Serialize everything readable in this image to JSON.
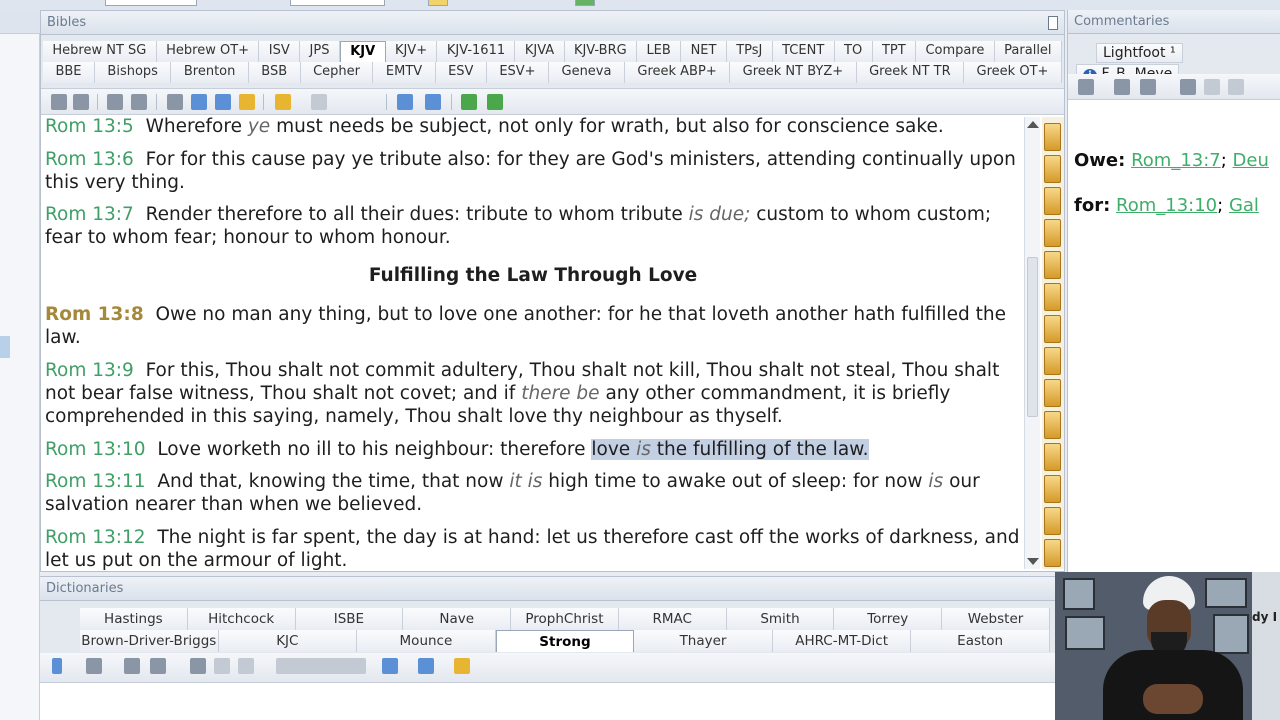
{
  "bibles_pane": {
    "title": "Bibles",
    "tabs_row1": [
      "Hebrew NT SG",
      "Hebrew OT+",
      "ISV",
      "JPS",
      "KJV",
      "KJV+",
      "KJV-1611",
      "KJVA",
      "KJV-BRG",
      "LEB",
      "NET",
      "TPsJ",
      "TCENT",
      "TO",
      "TPT",
      "Compare",
      "Parallel"
    ],
    "tabs_row2": [
      "BBE",
      "Bishops",
      "Brenton",
      "BSB",
      "Cepher",
      "EMTV",
      "ESV",
      "ESV+",
      "Geneva",
      "Greek ABP+",
      "Greek NT BYZ+",
      "Greek NT TR",
      "Greek OT+"
    ],
    "active_tab": "KJV",
    "verses": [
      {
        "ref": "Rom 13:5",
        "parts": [
          {
            "t": "Wherefore "
          },
          {
            "t": "ye",
            "i": true
          },
          {
            "t": " must needs be subject, not only for wrath, but also for conscience sake."
          }
        ]
      },
      {
        "ref": "Rom 13:6",
        "parts": [
          {
            "t": "For for this cause pay ye tribute also: for they are God's ministers, attending continually upon this very thing."
          }
        ]
      },
      {
        "ref": "Rom 13:7",
        "parts": [
          {
            "t": "Render therefore to all their dues: tribute to whom tribute "
          },
          {
            "t": "is due;",
            "i": true
          },
          {
            "t": " custom to whom custom; fear to whom fear; honour to whom honour."
          }
        ]
      },
      {
        "ref": "Rom 13:8",
        "current": true,
        "parts": [
          {
            "t": "Owe no man any thing, but to love one another: for he that loveth another hath fulfilled the law."
          }
        ]
      },
      {
        "ref": "Rom 13:9",
        "parts": [
          {
            "t": "For this, Thou shalt not commit adultery, Thou shalt not kill, Thou shalt not steal, Thou shalt not bear false witness, Thou shalt not covet; and if "
          },
          {
            "t": "there be",
            "i": true
          },
          {
            "t": " any other commandment, it is briefly comprehended in this saying, namely, Thou shalt love thy neighbour as thyself."
          }
        ]
      },
      {
        "ref": "Rom 13:10",
        "parts": [
          {
            "t": "Love worketh no ill to his neighbour: therefore "
          },
          {
            "t": "love ",
            "h": true
          },
          {
            "t": "is",
            "i": true,
            "h": true
          },
          {
            "t": " the fulfilling of the law.",
            "h": true
          }
        ]
      },
      {
        "ref": "Rom 13:11",
        "parts": [
          {
            "t": "And that, knowing the time, that now "
          },
          {
            "t": "it is",
            "i": true
          },
          {
            "t": " high time to awake out of sleep: for now "
          },
          {
            "t": "is",
            "i": true
          },
          {
            "t": " our salvation nearer than when we believed."
          }
        ]
      },
      {
        "ref": "Rom 13:12",
        "parts": [
          {
            "t": "The night is far spent, the day is at hand: let us therefore cast off the works of darkness, and let us put on the armour of light."
          }
        ]
      }
    ],
    "section_heading": "Fulfilling the Law Through Love"
  },
  "commentaries_pane": {
    "title": "Commentaries",
    "tabs": [
      "Lightfoot ¹",
      "F. B. Meye"
    ],
    "info_glyph": "i",
    "lines": [
      {
        "label": "Owe:",
        "links": [
          "Rom_13:7",
          "Deu"
        ]
      },
      {
        "label": "for:",
        "links": [
          "Rom_13:10",
          "Gal"
        ]
      }
    ]
  },
  "dictionaries_pane": {
    "title": "Dictionaries",
    "tabs_row1": [
      "Hastings",
      "Hitchcock",
      "ISBE",
      "Nave",
      "ProphChrist",
      "RMAC",
      "Smith",
      "Torrey",
      "Webster"
    ],
    "tabs_row2": [
      "Brown-Driver-Briggs",
      "KJC",
      "Mounce",
      "Strong",
      "Thayer",
      "AHRC-MT-Dict",
      "Easton"
    ],
    "active_tab": "Strong"
  },
  "webcam_overlay": {
    "partial_text": "dy I"
  }
}
